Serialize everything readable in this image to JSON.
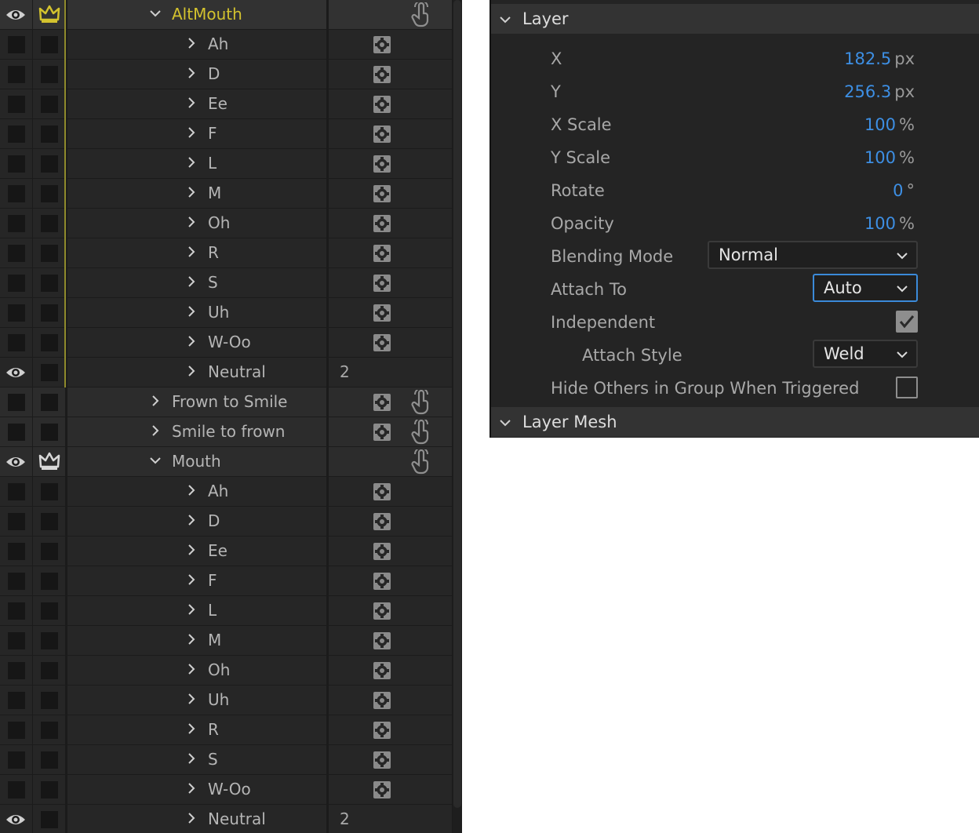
{
  "layers": {
    "rows": [
      {
        "name": "AltMouth",
        "level": 0,
        "expanded": true,
        "group": true,
        "active": true,
        "eye": true,
        "crown": "gold",
        "gold_text": true,
        "hand": true
      },
      {
        "name": "Ah",
        "level": 1,
        "gear": true
      },
      {
        "name": "D",
        "level": 1,
        "gear": true
      },
      {
        "name": "Ee",
        "level": 1,
        "gear": true
      },
      {
        "name": "F",
        "level": 1,
        "gear": true
      },
      {
        "name": "L",
        "level": 1,
        "gear": true
      },
      {
        "name": "M",
        "level": 1,
        "gear": true
      },
      {
        "name": "Oh",
        "level": 1,
        "gear": true
      },
      {
        "name": "R",
        "level": 1,
        "gear": true
      },
      {
        "name": "S",
        "level": 1,
        "gear": true
      },
      {
        "name": "Uh",
        "level": 1,
        "gear": true
      },
      {
        "name": "W-Oo",
        "level": 1,
        "gear": true
      },
      {
        "name": "Neutral",
        "level": 1,
        "eye": true,
        "num": "2"
      },
      {
        "name": "Frown to Smile",
        "level": 0,
        "group": true,
        "gear": true,
        "hand": true
      },
      {
        "name": "Smile to frown",
        "level": 0,
        "group": true,
        "gear": true,
        "hand": true
      },
      {
        "name": "Mouth",
        "level": 0,
        "expanded": true,
        "group": true,
        "eye": true,
        "crown": "white",
        "hand": true
      },
      {
        "name": "Ah",
        "level": 1,
        "gear": true
      },
      {
        "name": "D",
        "level": 1,
        "gear": true
      },
      {
        "name": "Ee",
        "level": 1,
        "gear": true
      },
      {
        "name": "F",
        "level": 1,
        "gear": true
      },
      {
        "name": "L",
        "level": 1,
        "gear": true
      },
      {
        "name": "M",
        "level": 1,
        "gear": true
      },
      {
        "name": "Oh",
        "level": 1,
        "gear": true
      },
      {
        "name": "Uh",
        "level": 1,
        "gear": true
      },
      {
        "name": "R",
        "level": 1,
        "gear": true
      },
      {
        "name": "S",
        "level": 1,
        "gear": true
      },
      {
        "name": "W-Oo",
        "level": 1,
        "gear": true
      },
      {
        "name": "Neutral",
        "level": 1,
        "eye": true,
        "num": "2"
      }
    ]
  },
  "properties": {
    "layer_section": "Layer",
    "mesh_section": "Layer Mesh",
    "x": {
      "label": "X",
      "value": "182.5",
      "unit": "px"
    },
    "y": {
      "label": "Y",
      "value": "256.3",
      "unit": "px"
    },
    "x_scale": {
      "label": "X Scale",
      "value": "100",
      "unit": "%"
    },
    "y_scale": {
      "label": "Y Scale",
      "value": "100",
      "unit": "%"
    },
    "rotate": {
      "label": "Rotate",
      "value": "0",
      "unit": "°"
    },
    "opacity": {
      "label": "Opacity",
      "value": "100",
      "unit": "%"
    },
    "blending_mode": {
      "label": "Blending Mode",
      "value": "Normal"
    },
    "attach_to": {
      "label": "Attach To",
      "value": "Auto"
    },
    "independent": {
      "label": "Independent",
      "checked": true
    },
    "attach_style": {
      "label": "Attach Style",
      "value": "Weld"
    },
    "hide_others": {
      "label": "Hide Others in Group When Triggered",
      "checked": false
    }
  },
  "colors": {
    "accent_blue": "#3d8fe4",
    "gold": "#d3c22e",
    "focus_border": "#3b8ad9"
  }
}
